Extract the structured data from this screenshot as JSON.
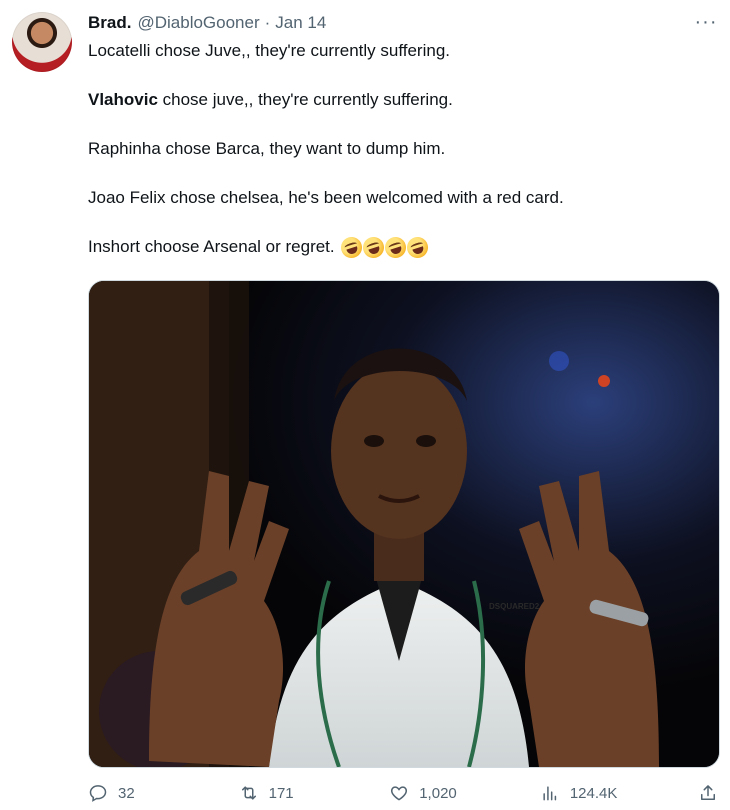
{
  "tweet": {
    "author_name": "Brad.",
    "author_handle": "@DiabloGooner",
    "separator": "·",
    "date": "Jan 14",
    "more_label": "···",
    "lines": {
      "line1": "Locatelli chose Juve,, they're currently suffering.",
      "line2_bold": "Vlahovic",
      "line2_rest": " chose juve,, they're currently suffering.",
      "line3": "Raphinha chose Barca, they want to dump him.",
      "line4": "Joao Felix chose chelsea, he's been welcomed with a red card.",
      "line5": "Inshort choose Arsenal or regret."
    },
    "emoji_names": [
      "rolling-on-floor-laughing",
      "rolling-on-floor-laughing",
      "rolling-on-floor-laughing",
      "rolling-on-floor-laughing"
    ],
    "media_text": "DSQUARED2"
  },
  "actions": {
    "replies": "32",
    "retweets": "171",
    "likes": "1,020",
    "views": "124.4K"
  },
  "icons": [
    "reply-icon",
    "retweet-icon",
    "like-icon",
    "views-icon",
    "share-icon",
    "more-icon"
  ],
  "colors": {
    "text": "#0f1419",
    "muted": "#536471",
    "border": "#cfd9de"
  }
}
